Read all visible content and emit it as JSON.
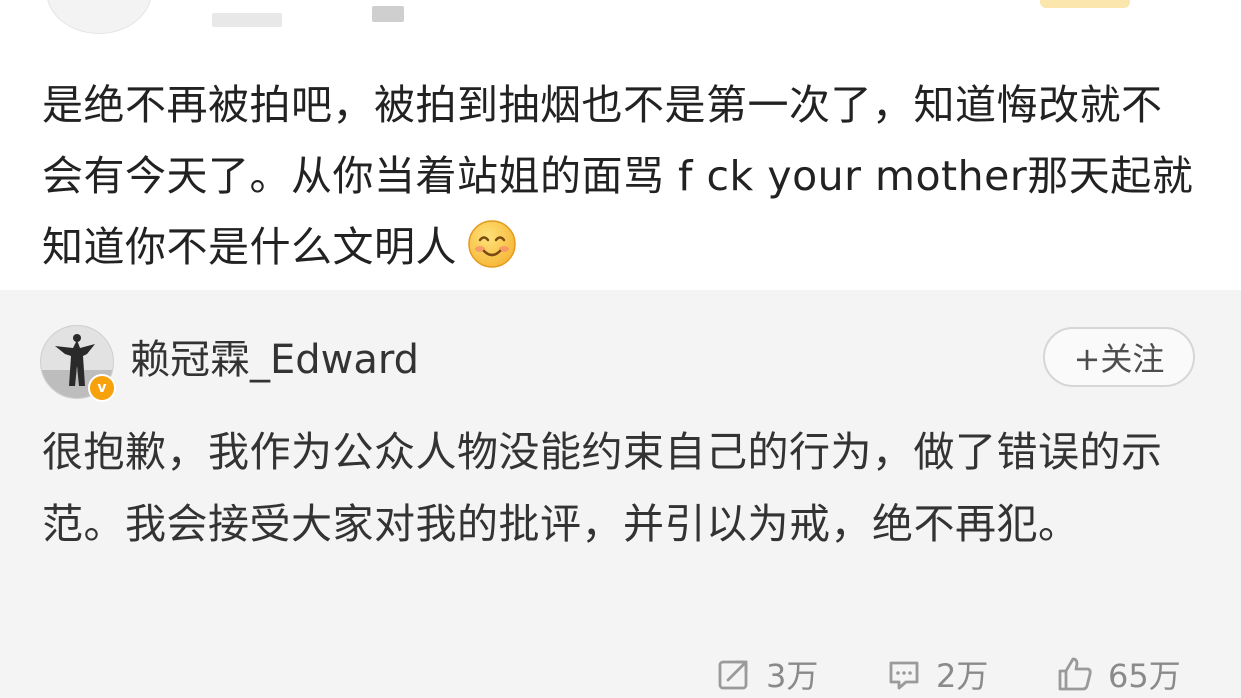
{
  "original_comment": {
    "text": "是绝不再被拍吧，被拍到抽烟也不是第一次了，知道悔改就不会有今天了。从你当着站姐的面骂 f ck your mother那天起就知道你不是什么文明人",
    "emoji": "smile-emoji"
  },
  "reply": {
    "username": "赖冠霖_Edward",
    "verified": true,
    "verified_badge_label": "v",
    "follow_button_label": "+关注",
    "text": "很抱歉，我作为公众人物没能约束自己的行为，做了错误的示范。我会接受大家对我的批评，并引以为戒，绝不再犯。",
    "actions": {
      "share_count": "3万",
      "comment_count": "2万",
      "like_count": "65万"
    }
  },
  "colors": {
    "reply_background": "#f4f4f4",
    "verified_badge": "#f7a10d",
    "action_text": "#8a8a8a"
  }
}
